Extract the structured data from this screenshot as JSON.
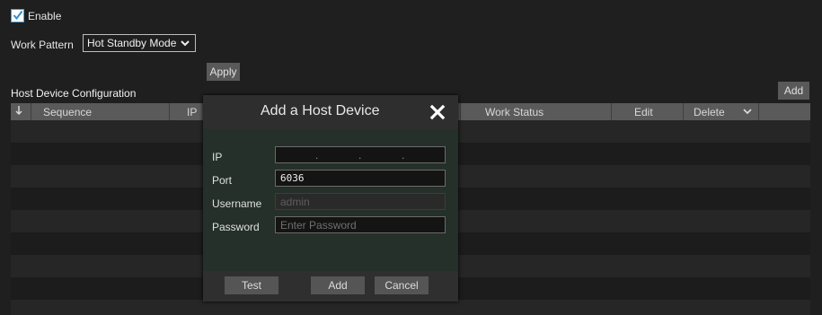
{
  "enable": {
    "label": "Enable",
    "checked": true
  },
  "work_pattern": {
    "label": "Work Pattern",
    "value": "Hot Standby Mode"
  },
  "apply_label": "Apply",
  "host_section": {
    "title": "Host Device Configuration",
    "add_label": "Add"
  },
  "table": {
    "columns": [
      "Sequence",
      "IP",
      "Work Status",
      "Edit",
      "Delete"
    ],
    "sort_icon": "arrow-down-icon",
    "rows": []
  },
  "modal": {
    "title": "Add a Host Device",
    "ip_label": "IP",
    "port_label": "Port",
    "port_value": "6036",
    "username_label": "Username",
    "username_value": "admin",
    "password_label": "Password",
    "password_placeholder": "Enter Password",
    "test_label": "Test",
    "add_label": "Add",
    "cancel_label": "Cancel"
  },
  "colors": {
    "accent": "#4aa3df",
    "dialog_bg": "#243029"
  }
}
